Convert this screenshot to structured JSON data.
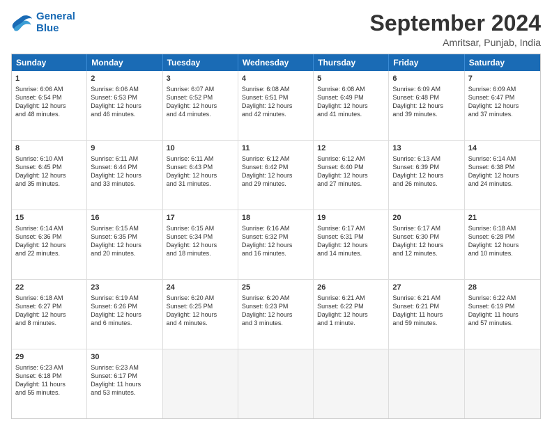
{
  "logo": {
    "line1": "General",
    "line2": "Blue"
  },
  "title": "September 2024",
  "subtitle": "Amritsar, Punjab, India",
  "days": [
    "Sunday",
    "Monday",
    "Tuesday",
    "Wednesday",
    "Thursday",
    "Friday",
    "Saturday"
  ],
  "rows": [
    [
      {
        "day": "1",
        "lines": [
          "Sunrise: 6:06 AM",
          "Sunset: 6:54 PM",
          "Daylight: 12 hours",
          "and 48 minutes."
        ]
      },
      {
        "day": "2",
        "lines": [
          "Sunrise: 6:06 AM",
          "Sunset: 6:53 PM",
          "Daylight: 12 hours",
          "and 46 minutes."
        ]
      },
      {
        "day": "3",
        "lines": [
          "Sunrise: 6:07 AM",
          "Sunset: 6:52 PM",
          "Daylight: 12 hours",
          "and 44 minutes."
        ]
      },
      {
        "day": "4",
        "lines": [
          "Sunrise: 6:08 AM",
          "Sunset: 6:51 PM",
          "Daylight: 12 hours",
          "and 42 minutes."
        ]
      },
      {
        "day": "5",
        "lines": [
          "Sunrise: 6:08 AM",
          "Sunset: 6:49 PM",
          "Daylight: 12 hours",
          "and 41 minutes."
        ]
      },
      {
        "day": "6",
        "lines": [
          "Sunrise: 6:09 AM",
          "Sunset: 6:48 PM",
          "Daylight: 12 hours",
          "and 39 minutes."
        ]
      },
      {
        "day": "7",
        "lines": [
          "Sunrise: 6:09 AM",
          "Sunset: 6:47 PM",
          "Daylight: 12 hours",
          "and 37 minutes."
        ]
      }
    ],
    [
      {
        "day": "8",
        "lines": [
          "Sunrise: 6:10 AM",
          "Sunset: 6:45 PM",
          "Daylight: 12 hours",
          "and 35 minutes."
        ]
      },
      {
        "day": "9",
        "lines": [
          "Sunrise: 6:11 AM",
          "Sunset: 6:44 PM",
          "Daylight: 12 hours",
          "and 33 minutes."
        ]
      },
      {
        "day": "10",
        "lines": [
          "Sunrise: 6:11 AM",
          "Sunset: 6:43 PM",
          "Daylight: 12 hours",
          "and 31 minutes."
        ]
      },
      {
        "day": "11",
        "lines": [
          "Sunrise: 6:12 AM",
          "Sunset: 6:42 PM",
          "Daylight: 12 hours",
          "and 29 minutes."
        ]
      },
      {
        "day": "12",
        "lines": [
          "Sunrise: 6:12 AM",
          "Sunset: 6:40 PM",
          "Daylight: 12 hours",
          "and 27 minutes."
        ]
      },
      {
        "day": "13",
        "lines": [
          "Sunrise: 6:13 AM",
          "Sunset: 6:39 PM",
          "Daylight: 12 hours",
          "and 26 minutes."
        ]
      },
      {
        "day": "14",
        "lines": [
          "Sunrise: 6:14 AM",
          "Sunset: 6:38 PM",
          "Daylight: 12 hours",
          "and 24 minutes."
        ]
      }
    ],
    [
      {
        "day": "15",
        "lines": [
          "Sunrise: 6:14 AM",
          "Sunset: 6:36 PM",
          "Daylight: 12 hours",
          "and 22 minutes."
        ]
      },
      {
        "day": "16",
        "lines": [
          "Sunrise: 6:15 AM",
          "Sunset: 6:35 PM",
          "Daylight: 12 hours",
          "and 20 minutes."
        ]
      },
      {
        "day": "17",
        "lines": [
          "Sunrise: 6:15 AM",
          "Sunset: 6:34 PM",
          "Daylight: 12 hours",
          "and 18 minutes."
        ]
      },
      {
        "day": "18",
        "lines": [
          "Sunrise: 6:16 AM",
          "Sunset: 6:32 PM",
          "Daylight: 12 hours",
          "and 16 minutes."
        ]
      },
      {
        "day": "19",
        "lines": [
          "Sunrise: 6:17 AM",
          "Sunset: 6:31 PM",
          "Daylight: 12 hours",
          "and 14 minutes."
        ]
      },
      {
        "day": "20",
        "lines": [
          "Sunrise: 6:17 AM",
          "Sunset: 6:30 PM",
          "Daylight: 12 hours",
          "and 12 minutes."
        ]
      },
      {
        "day": "21",
        "lines": [
          "Sunrise: 6:18 AM",
          "Sunset: 6:28 PM",
          "Daylight: 12 hours",
          "and 10 minutes."
        ]
      }
    ],
    [
      {
        "day": "22",
        "lines": [
          "Sunrise: 6:18 AM",
          "Sunset: 6:27 PM",
          "Daylight: 12 hours",
          "and 8 minutes."
        ]
      },
      {
        "day": "23",
        "lines": [
          "Sunrise: 6:19 AM",
          "Sunset: 6:26 PM",
          "Daylight: 12 hours",
          "and 6 minutes."
        ]
      },
      {
        "day": "24",
        "lines": [
          "Sunrise: 6:20 AM",
          "Sunset: 6:25 PM",
          "Daylight: 12 hours",
          "and 4 minutes."
        ]
      },
      {
        "day": "25",
        "lines": [
          "Sunrise: 6:20 AM",
          "Sunset: 6:23 PM",
          "Daylight: 12 hours",
          "and 3 minutes."
        ]
      },
      {
        "day": "26",
        "lines": [
          "Sunrise: 6:21 AM",
          "Sunset: 6:22 PM",
          "Daylight: 12 hours",
          "and 1 minute."
        ]
      },
      {
        "day": "27",
        "lines": [
          "Sunrise: 6:21 AM",
          "Sunset: 6:21 PM",
          "Daylight: 11 hours",
          "and 59 minutes."
        ]
      },
      {
        "day": "28",
        "lines": [
          "Sunrise: 6:22 AM",
          "Sunset: 6:19 PM",
          "Daylight: 11 hours",
          "and 57 minutes."
        ]
      }
    ],
    [
      {
        "day": "29",
        "lines": [
          "Sunrise: 6:23 AM",
          "Sunset: 6:18 PM",
          "Daylight: 11 hours",
          "and 55 minutes."
        ]
      },
      {
        "day": "30",
        "lines": [
          "Sunrise: 6:23 AM",
          "Sunset: 6:17 PM",
          "Daylight: 11 hours",
          "and 53 minutes."
        ]
      },
      {
        "day": "",
        "lines": [],
        "empty": true
      },
      {
        "day": "",
        "lines": [],
        "empty": true
      },
      {
        "day": "",
        "lines": [],
        "empty": true
      },
      {
        "day": "",
        "lines": [],
        "empty": true
      },
      {
        "day": "",
        "lines": [],
        "empty": true
      }
    ]
  ]
}
